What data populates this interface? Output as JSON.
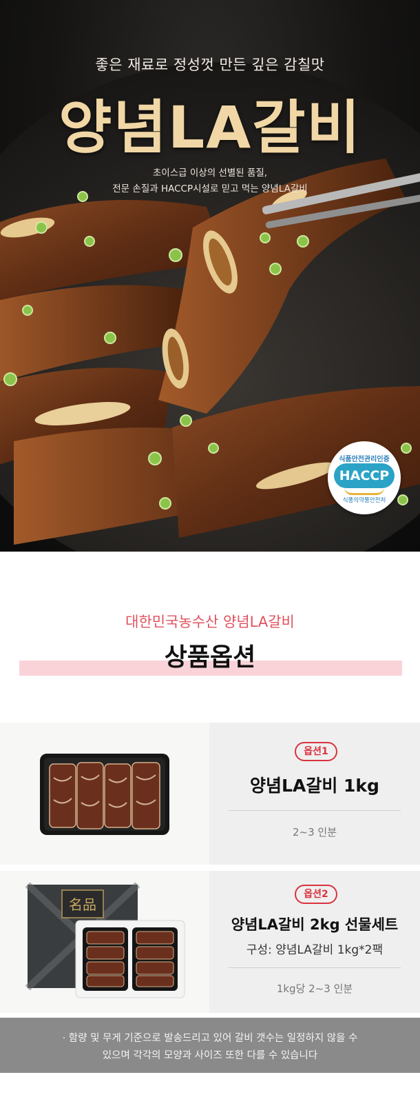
{
  "hero": {
    "subtitle": "좋은 재료로 정성껏 만든 깊은 감칠맛",
    "title": "양념LA갈비",
    "desc_line1": "초이스급 이상의 선별된 품질,",
    "desc_line2": "전문 손질과 HACCP시설로 믿고 먹는 양념LA갈비",
    "haccp": {
      "top": "식품안전관리인증",
      "mark": "HACCP",
      "bottom": "식품의약품안전처"
    }
  },
  "section": {
    "subtitle": "대한민국농수산 양념LA갈비",
    "title": "상품옵션"
  },
  "options": [
    {
      "badge": "옵션1",
      "name": "양념LA갈비 1kg",
      "serving": "2~3 인분"
    },
    {
      "badge": "옵션2",
      "name": "양념LA갈비 2kg 선물세트",
      "composition": "구성: 양념LA갈비 1kg*2팩",
      "serving": "1kg당 2~3 인분",
      "box_label": "名品"
    }
  ],
  "notice": {
    "line1": "· 함량 및 무게 기준으로 발송드리고 있어 갈비 갯수는 일정하지 않을 수",
    "line2": "있으며 각각의 모양과 사이즈 또한 다를 수 있습니다"
  },
  "colors": {
    "accent_red": "#d9323f",
    "section_pink": "#f9d3d7",
    "hero_title_gold": "#f1d7a6"
  }
}
